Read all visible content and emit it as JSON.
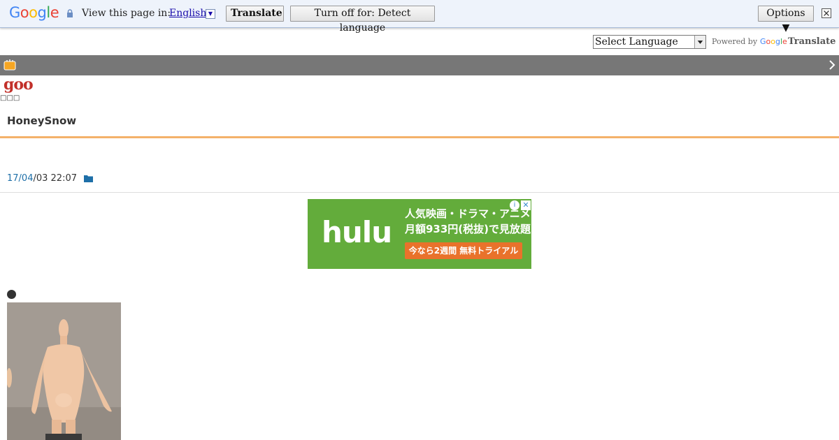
{
  "translate_bar": {
    "logo_letters": [
      {
        "ch": "G",
        "color": "#4285f4"
      },
      {
        "ch": "o",
        "color": "#ea4335"
      },
      {
        "ch": "o",
        "color": "#fbbc05"
      },
      {
        "ch": "g",
        "color": "#4285f4"
      },
      {
        "ch": "l",
        "color": "#34a853"
      },
      {
        "ch": "e",
        "color": "#ea4335"
      }
    ],
    "view_label": "View this page in:",
    "language": "English",
    "translate_button": "Translate",
    "turn_off_button": "Turn off for: Detect language",
    "options_button": "Options ▼"
  },
  "language_selector": {
    "selected": "Select Language",
    "powered_by": "Powered by",
    "powered_google": "Google",
    "powered_translate": "Translate"
  },
  "site": {
    "logo": "goo",
    "unrendered_glyphs": "□□□",
    "blog_title": "HoneySnow"
  },
  "post": {
    "date_link": "17/04",
    "date_rest": "/03 22:07"
  },
  "ad": {
    "brand": "hulu",
    "line1": "人気映画・ドラマ・アニメ",
    "line2": "月額933円(税抜)で見放題",
    "cta": "今なら2週間 無料トライアル",
    "info_icon": "info-icon",
    "close_icon": "close-icon"
  },
  "colors": {
    "accent_orange": "#f4b16a",
    "goo_red": "#c2302a",
    "link_blue": "#1e6fa8",
    "hulu_green": "#63ac3b"
  }
}
